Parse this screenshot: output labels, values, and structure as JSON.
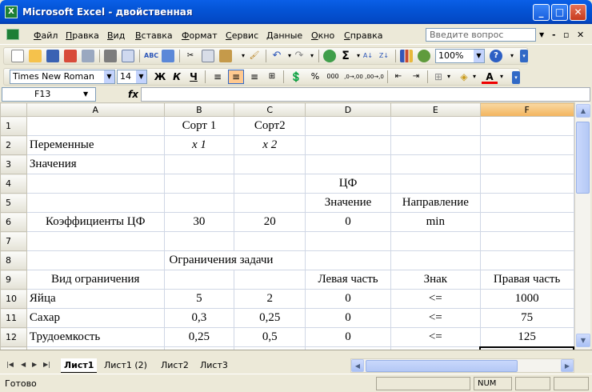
{
  "window": {
    "title": "Microsoft Excel - двойственная",
    "app_icon": "excel-icon"
  },
  "menu": {
    "items": [
      {
        "label": "Файл",
        "u": "Ф",
        "rest": "айл"
      },
      {
        "label": "Правка",
        "u": "П",
        "rest": "равка"
      },
      {
        "label": "Вид",
        "u": "В",
        "rest": "ид"
      },
      {
        "label": "Вставка",
        "u": "В",
        "rest": "ставка"
      },
      {
        "label": "Формат",
        "u": "Ф",
        "rest": "ормат"
      },
      {
        "label": "Сервис",
        "u": "С",
        "rest": "ервис"
      },
      {
        "label": "Данные",
        "u": "Д",
        "rest": "анные"
      },
      {
        "label": "Окно",
        "u": "О",
        "rest": "кно"
      },
      {
        "label": "Справка",
        "u": "С",
        "rest": "правка"
      }
    ],
    "ask_placeholder": "Введите вопрос"
  },
  "toolbar": {
    "zoom": "100%",
    "sum_symbol": "Σ"
  },
  "format_toolbar": {
    "font_name": "Times New Roman",
    "font_size": "14",
    "bold": "Ж",
    "italic": "К",
    "underline": "Ч",
    "percent": "%",
    "thousands": "000",
    "inc_decimal": ",0→,00",
    "dec_decimal": ",00→,0"
  },
  "formula_bar": {
    "name_box": "F13",
    "fx": "fx",
    "formula": ""
  },
  "grid": {
    "columns": [
      "A",
      "B",
      "C",
      "D",
      "E",
      "F"
    ],
    "selected_column": "F",
    "rows": [
      {
        "num": "1",
        "cells": [
          "",
          "Сорт 1",
          "Сорт2",
          "",
          "",
          ""
        ]
      },
      {
        "num": "2",
        "cells": [
          "Переменные",
          "x 1",
          "x 2",
          "",
          "",
          ""
        ]
      },
      {
        "num": "3",
        "cells": [
          "Значения",
          "",
          "",
          "",
          "",
          ""
        ]
      },
      {
        "num": "4",
        "cells": [
          "",
          "",
          "",
          "ЦФ",
          "",
          ""
        ]
      },
      {
        "num": "5",
        "cells": [
          "",
          "",
          "",
          "Значение",
          "Направление",
          ""
        ]
      },
      {
        "num": "6",
        "cells": [
          "Коэффициенты ЦФ",
          "30",
          "20",
          "0",
          "min",
          ""
        ]
      },
      {
        "num": "7",
        "cells": [
          "",
          "",
          "",
          "",
          "",
          ""
        ]
      },
      {
        "num": "8",
        "cells": [
          "",
          "Ограничения задачи",
          "",
          "",
          "",
          ""
        ]
      },
      {
        "num": "9",
        "cells": [
          "Вид ограничения",
          "",
          "",
          "Левая часть",
          "Знак",
          "Правая часть"
        ]
      },
      {
        "num": "10",
        "cells": [
          "Яйца",
          "5",
          "2",
          "0",
          "<=",
          "1000"
        ]
      },
      {
        "num": "11",
        "cells": [
          "Сахар",
          "0,3",
          "0,25",
          "0",
          "<=",
          "75"
        ]
      },
      {
        "num": "12",
        "cells": [
          "Трудоемкость",
          "0,25",
          "0,5",
          "0",
          "<=",
          "125"
        ]
      }
    ]
  },
  "sheets": {
    "tabs": [
      "Лист1",
      "Лист1 (2)",
      "Лист2",
      "Лист3"
    ],
    "active": "Лист1"
  },
  "status": {
    "text": "Готово",
    "num": "NUM"
  },
  "colors": {
    "title_bar": "#0454d6",
    "selected_header": "#f3b45c",
    "grid_line": "#d0d7e5"
  }
}
